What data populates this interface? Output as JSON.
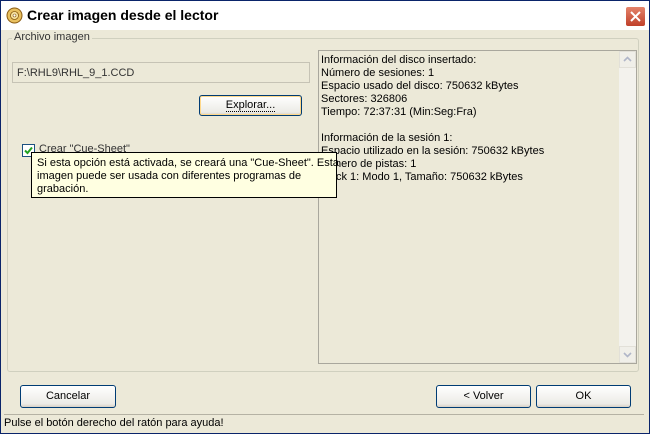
{
  "window": {
    "title": "Crear imagen desde el lector",
    "icon": "disc-burner-icon",
    "close": "close-icon"
  },
  "group": {
    "label": "Archivo imagen",
    "path_value": "F:\\RHL9\\RHL_9_1.CCD",
    "explore_label": "Explorar..."
  },
  "cue_sheet": {
    "label": "Crear \"Cue-Sheet\"",
    "checked": true
  },
  "tooltip": {
    "lines": [
      "Si esta opción está activada, se creará una \"Cue-Sheet\". Esta",
      "imagen puede ser usada con diferentes programas de",
      "grabación."
    ]
  },
  "disc_info": {
    "lines": [
      "Información del disco insertado:",
      "Número de sesiones: 1",
      "Espacio usado del disco: 750632 kBytes",
      "Sectores: 326806",
      "Tiempo: 72:37:31 (Min:Seg:Fra)",
      "",
      "Información de la sesión 1:",
      "Espacio utilizado en la sesión: 750632 kBytes",
      "mero de pistas: 1",
      "ck 1: Modo 1, Tamaño: 750632 kBytes"
    ]
  },
  "buttons": {
    "cancel": "Cancelar",
    "back": "< Volver",
    "ok": "OK"
  },
  "status": "Pulse el botón derecho del ratón para ayuda!",
  "colors": {
    "close_red": "#c0402a",
    "tooltip_bg": "#ffffe1",
    "dialog_bg": "#ece9d8"
  }
}
